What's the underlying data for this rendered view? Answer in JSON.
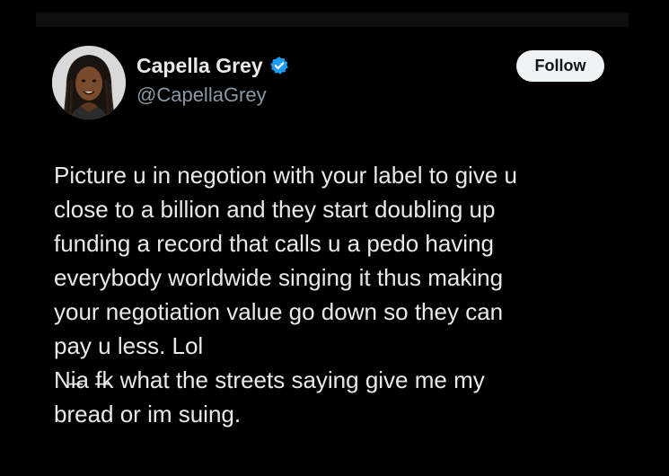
{
  "user": {
    "display_name": "Capella Grey",
    "handle": "@CapellaGrey",
    "verified_badge_icon": "verified-badge-icon",
    "avatar_icon": "profile-photo"
  },
  "follow_button": {
    "label": "Follow"
  },
  "tweet": {
    "lines": [
      "Picture u in negotion with your label to give u",
      "close to a billion and they start doubling up",
      "funding a record that calls u a pedo having",
      "everybody worldwide singing it thus making",
      "your negotiation value go down so they can",
      "pay u less. Lol",
      "Ni̶̶a f̶̶k what the streets saying give me my",
      "bread or im suing."
    ]
  },
  "colors": {
    "background": "#000000",
    "text_primary": "#e7e9ea",
    "text_secondary": "#8b98a5",
    "verified_blue": "#1d9bf0",
    "follow_bg": "#eff3f4"
  }
}
